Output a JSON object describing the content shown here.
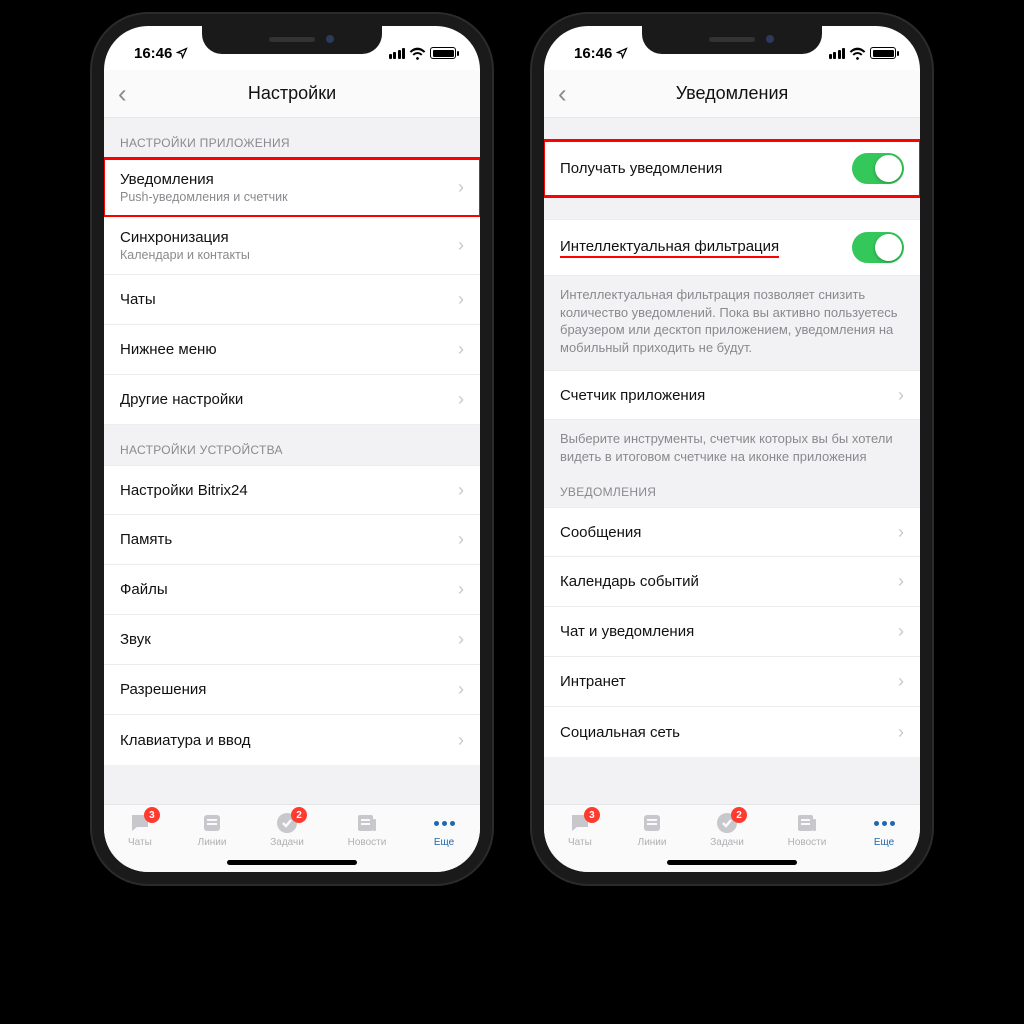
{
  "status": {
    "time": "16:46"
  },
  "phone1": {
    "title": "Настройки",
    "section_app": "НАСТРОЙКИ ПРИЛОЖЕНИЯ",
    "section_device": "НАСТРОЙКИ УСТРОЙСТВА",
    "rows_app": {
      "notifications": {
        "title": "Уведомления",
        "subtitle": "Push-уведомления и счетчик"
      },
      "sync": {
        "title": "Синхронизация",
        "subtitle": "Календари и контакты"
      },
      "chats": {
        "title": "Чаты"
      },
      "bottom_menu": {
        "title": "Нижнее меню"
      },
      "other": {
        "title": "Другие настройки"
      }
    },
    "rows_device": {
      "bitrix": {
        "title": "Настройки Bitrix24"
      },
      "memory": {
        "title": "Память"
      },
      "files": {
        "title": "Файлы"
      },
      "sound": {
        "title": "Звук"
      },
      "permissions": {
        "title": "Разрешения"
      },
      "keyboard": {
        "title": "Клавиатура и ввод"
      }
    }
  },
  "phone2": {
    "title": "Уведомления",
    "receive": {
      "title": "Получать уведомления"
    },
    "filter": {
      "title": "Интеллектуальная фильтрация"
    },
    "filter_desc": "Интеллектуальная фильтрация позволяет снизить количество уведомлений. Пока вы активно пользуетесь браузером или десктоп приложением, уведомления на мобильный приходить не будут.",
    "counter": {
      "title": "Счетчик приложения"
    },
    "counter_desc": "Выберите инструменты, счетчик которых вы бы хотели видеть в итоговом счетчике на иконке приложения",
    "section_notif": "УВЕДОМЛЕНИЯ",
    "items": {
      "messages": "Сообщения",
      "calendar": "Календарь событий",
      "chat": "Чат и уведомления",
      "intranet": "Интранет",
      "social": "Социальная сеть"
    }
  },
  "tabs": {
    "chats": {
      "label": "Чаты",
      "badge": "3"
    },
    "lines": {
      "label": "Линии"
    },
    "tasks": {
      "label": "Задачи",
      "badge": "2"
    },
    "news": {
      "label": "Новости"
    },
    "more": {
      "label": "Еще"
    }
  }
}
